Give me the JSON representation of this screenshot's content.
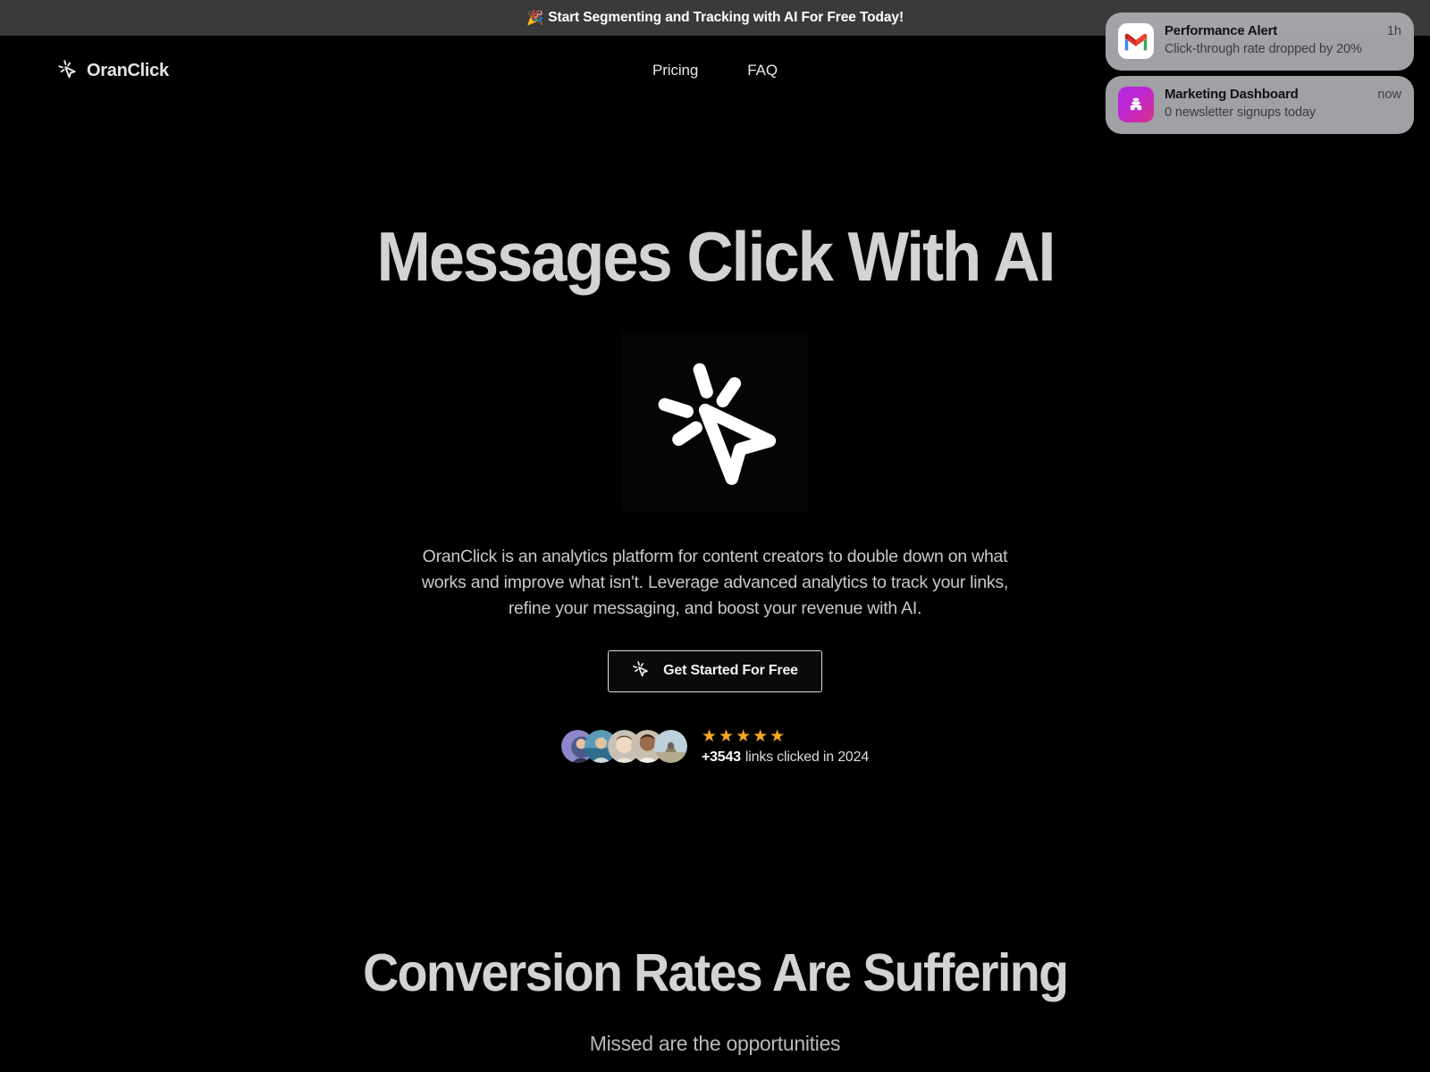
{
  "banner": {
    "emoji": "🎉",
    "text": "Start Segmenting and Tracking with AI For Free Today!"
  },
  "nav": {
    "brand": "OranClick",
    "brand_icon": "click-cursor-icon",
    "links": [
      {
        "label": "Pricing",
        "name": "nav-link-pricing"
      },
      {
        "label": "FAQ",
        "name": "nav-link-faq"
      }
    ]
  },
  "notifications": [
    {
      "app_icon": "gmail-icon",
      "title": "Performance Alert",
      "time": "1h",
      "message": "Click-through rate dropped by 20%"
    },
    {
      "app_icon": "hive-dashboard-icon",
      "title": "Marketing Dashboard",
      "time": "now",
      "message": "0 newsletter signups today"
    }
  ],
  "hero": {
    "title": "Messages Click With AI",
    "visual_icon": "click-cursor-icon",
    "description": "OranClick is an analytics platform for content creators to double down on what works and improve what isn't. Leverage advanced analytics to track your links, refine your messaging, and boost your revenue with AI.",
    "cta_label": "Get Started For Free",
    "cta_icon": "click-cursor-icon",
    "social_proof": {
      "stars": [
        "★",
        "★",
        "★",
        "★",
        "★"
      ],
      "star_count": 5,
      "count": "+3543",
      "caption": "links clicked in 2024",
      "avatar_count": 5
    }
  },
  "section2": {
    "title": "Conversion Rates Are Suffering",
    "subtitle": "Missed are the opportunities"
  },
  "colors": {
    "page_bg": "#000000",
    "banner_bg": "#3a3a3a",
    "heading": "#d3d3d3",
    "notification_bg": "#acadb0",
    "star": "#f5a623",
    "cta_border": "#dcdcdc"
  }
}
